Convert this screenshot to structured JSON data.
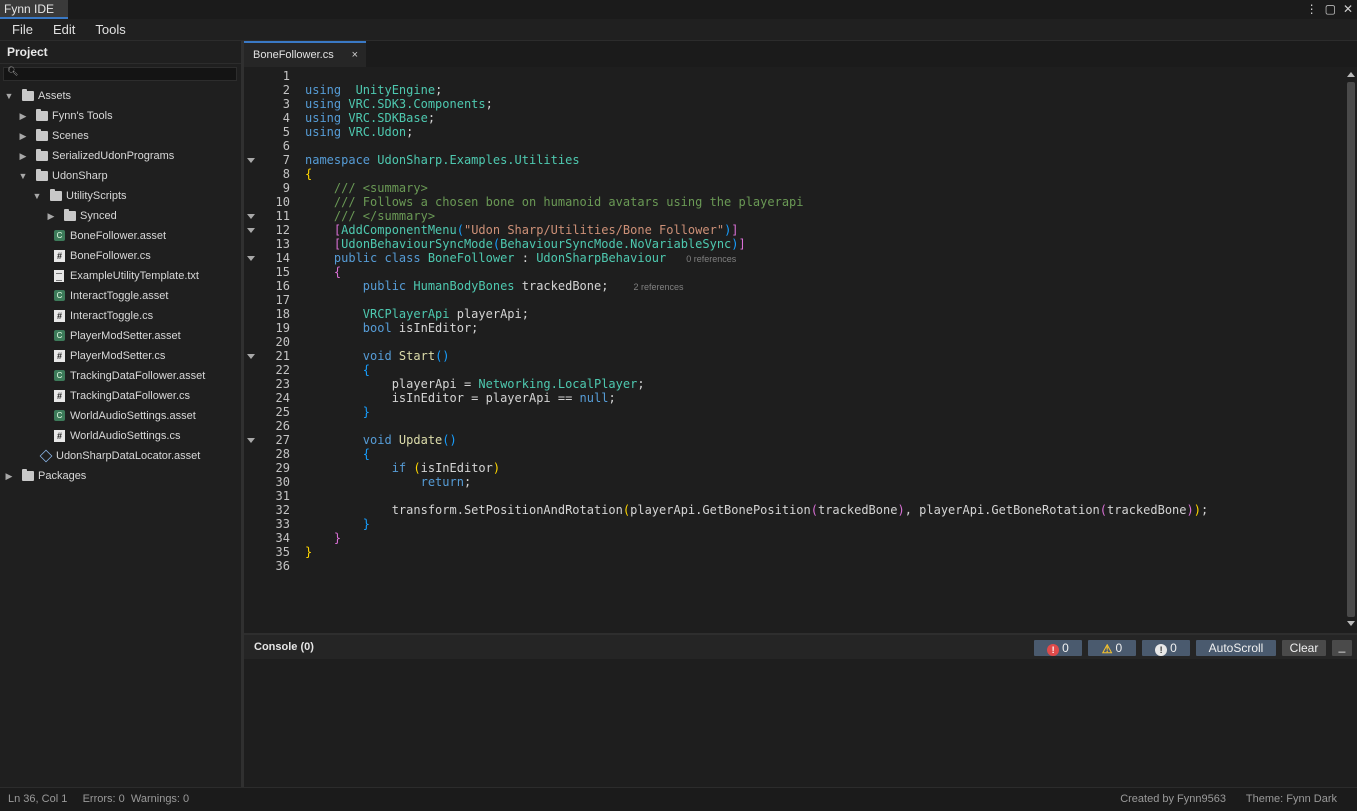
{
  "app": {
    "title": "Fynn IDE",
    "window_buttons": [
      "⋮",
      "▢",
      "✕"
    ]
  },
  "menu": [
    "File",
    "Edit",
    "Tools"
  ],
  "sidebar": {
    "title": "Project",
    "search_placeholder": "",
    "tree": [
      {
        "label": "Assets",
        "type": "folder",
        "depth": 0,
        "expanded": true
      },
      {
        "label": "Fynn's Tools",
        "type": "folder",
        "depth": 1,
        "expanded": false
      },
      {
        "label": "Scenes",
        "type": "folder",
        "depth": 1,
        "expanded": false
      },
      {
        "label": "SerializedUdonPrograms",
        "type": "folder",
        "depth": 1,
        "expanded": false
      },
      {
        "label": "UdonSharp",
        "type": "folder",
        "depth": 1,
        "expanded": true
      },
      {
        "label": "UtilityScripts",
        "type": "folder",
        "depth": 2,
        "expanded": true
      },
      {
        "label": "Synced",
        "type": "folder",
        "depth": 3,
        "expanded": false
      },
      {
        "label": "BoneFollower.asset",
        "type": "asset",
        "depth": 3
      },
      {
        "label": "BoneFollower.cs",
        "type": "cs",
        "depth": 3
      },
      {
        "label": "ExampleUtilityTemplate.txt",
        "type": "txt",
        "depth": 3
      },
      {
        "label": "InteractToggle.asset",
        "type": "asset",
        "depth": 3
      },
      {
        "label": "InteractToggle.cs",
        "type": "cs",
        "depth": 3
      },
      {
        "label": "PlayerModSetter.asset",
        "type": "asset",
        "depth": 3
      },
      {
        "label": "PlayerModSetter.cs",
        "type": "cs",
        "depth": 3
      },
      {
        "label": "TrackingDataFollower.asset",
        "type": "asset",
        "depth": 3
      },
      {
        "label": "TrackingDataFollower.cs",
        "type": "cs",
        "depth": 3
      },
      {
        "label": "WorldAudioSettings.asset",
        "type": "asset",
        "depth": 3
      },
      {
        "label": "WorldAudioSettings.cs",
        "type": "cs",
        "depth": 3
      },
      {
        "label": "UdonSharpDataLocator.asset",
        "type": "locator",
        "depth": 2
      },
      {
        "label": "Packages",
        "type": "folder",
        "depth": 0,
        "expanded": false
      }
    ]
  },
  "editor": {
    "tab": {
      "label": "BoneFollower.cs",
      "close": "×"
    },
    "fold_lines": [
      7,
      11,
      12,
      14,
      21,
      27
    ],
    "lines": [
      [],
      [
        [
          "k",
          "using"
        ],
        [
          "",
          "  "
        ],
        [
          "t",
          "UnityEngine"
        ],
        [
          "",
          ";"
        ]
      ],
      [
        [
          "k",
          "using"
        ],
        [
          "",
          ""
        ],
        [
          "t",
          " VRC.SDK3.Components"
        ],
        [
          "",
          ";"
        ]
      ],
      [
        [
          "k",
          "using"
        ],
        [
          "t",
          " VRC.SDKBase"
        ],
        [
          "",
          ";"
        ]
      ],
      [
        [
          "k",
          "using"
        ],
        [
          "t",
          " VRC.Udon"
        ],
        [
          "",
          ";"
        ]
      ],
      [],
      [
        [
          "k",
          "namespace"
        ],
        [
          "t",
          " UdonSharp.Examples.Utilities"
        ]
      ],
      [
        [
          "p1",
          "{"
        ]
      ],
      [
        [
          "",
          ""
        ],
        [
          "c",
          "    /// <summary>"
        ]
      ],
      [
        [
          "c",
          "    /// Follows a chosen bone on humanoid avatars using the playerapi"
        ]
      ],
      [
        [
          "c",
          "    /// </summary>"
        ]
      ],
      [
        [
          "",
          "    "
        ],
        [
          "p2",
          "["
        ],
        [
          "t",
          "AddComponentMenu"
        ],
        [
          "p3",
          "("
        ],
        [
          "s",
          "\"Udon Sharp/Utilities/Bone Follower\""
        ],
        [
          "p3",
          ")"
        ],
        [
          "p2",
          "]"
        ]
      ],
      [
        [
          "",
          "    "
        ],
        [
          "p2",
          "["
        ],
        [
          "t",
          "UdonBehaviourSyncMode"
        ],
        [
          "p3",
          "("
        ],
        [
          "t",
          "BehaviourSyncMode.NoVariableSync"
        ],
        [
          "p3",
          ")"
        ],
        [
          "p2",
          "]"
        ]
      ],
      [
        [
          "k",
          "    public class"
        ],
        [
          "t",
          " BoneFollower"
        ],
        [
          "",
          " : "
        ],
        [
          "t",
          "UdonSharpBehaviour"
        ],
        [
          "h",
          "        0 references"
        ]
      ],
      [
        [
          "",
          "    "
        ],
        [
          "p2",
          "{"
        ]
      ],
      [
        [
          "k",
          "        public"
        ],
        [
          "t",
          " HumanBodyBones"
        ],
        [
          "",
          " trackedBone;"
        ],
        [
          "h",
          "          2 references"
        ]
      ],
      [],
      [
        [
          "t",
          "        VRCPlayerApi"
        ],
        [
          "",
          " playerApi;"
        ]
      ],
      [
        [
          "k",
          "        bool"
        ],
        [
          "",
          " isInEditor;"
        ]
      ],
      [],
      [
        [
          "k",
          "        void"
        ],
        [
          "f",
          " Start"
        ],
        [
          "p3",
          "()"
        ]
      ],
      [
        [
          "",
          "        "
        ],
        [
          "p3",
          "{"
        ]
      ],
      [
        [
          "",
          "            playerApi = "
        ],
        [
          "t",
          "Networking.LocalPlayer"
        ],
        [
          "",
          ";"
        ]
      ],
      [
        [
          "",
          "            isInEditor = playerApi == "
        ],
        [
          "k",
          "null"
        ],
        [
          "",
          ";"
        ]
      ],
      [
        [
          "",
          "        "
        ],
        [
          "p3",
          "}"
        ]
      ],
      [],
      [
        [
          "k",
          "        void"
        ],
        [
          "f",
          " Update"
        ],
        [
          "p3",
          "()"
        ]
      ],
      [
        [
          "",
          "        "
        ],
        [
          "p3",
          "{"
        ]
      ],
      [
        [
          "k",
          "            if"
        ],
        [
          "",
          " "
        ],
        [
          "p1",
          "("
        ],
        [
          "",
          "isInEditor"
        ],
        [
          "p1",
          ")"
        ]
      ],
      [
        [
          "k",
          "                return"
        ],
        [
          "",
          ";"
        ]
      ],
      [],
      [
        [
          "",
          "            transform.SetPositionAndRotation"
        ],
        [
          "p1",
          "("
        ],
        [
          "",
          "playerApi.GetBonePosition"
        ],
        [
          "p2",
          "("
        ],
        [
          "",
          "trackedBone"
        ],
        [
          "p2",
          ")"
        ],
        [
          "",
          ", playerApi.GetBoneRotation"
        ],
        [
          "p2",
          "("
        ],
        [
          "",
          "trackedBone"
        ],
        [
          "p2",
          ")"
        ],
        [
          "p1",
          ")"
        ],
        [
          "",
          ";"
        ]
      ],
      [
        [
          "",
          "        "
        ],
        [
          "p3",
          "}"
        ]
      ],
      [
        [
          "",
          "    "
        ],
        [
          "p2",
          "}"
        ]
      ],
      [
        [
          "p1",
          "}"
        ]
      ],
      []
    ]
  },
  "console": {
    "title": "Console (0)",
    "errors": "0",
    "warnings": "0",
    "infos": "0",
    "autoscroll_label": "AutoScroll",
    "clear_label": "Clear",
    "minimize_label": "_"
  },
  "status": {
    "left": "Ln 36, Col 1     Errors: 0  Warnings: 0",
    "created_by": "Created by Fynn9563",
    "theme": "Theme: Fynn Dark"
  },
  "colors": {
    "accent": "#3a79c5",
    "keyword": "#569cd6",
    "type": "#4ec9b0",
    "comment": "#6a9955",
    "string": "#ce9178"
  }
}
